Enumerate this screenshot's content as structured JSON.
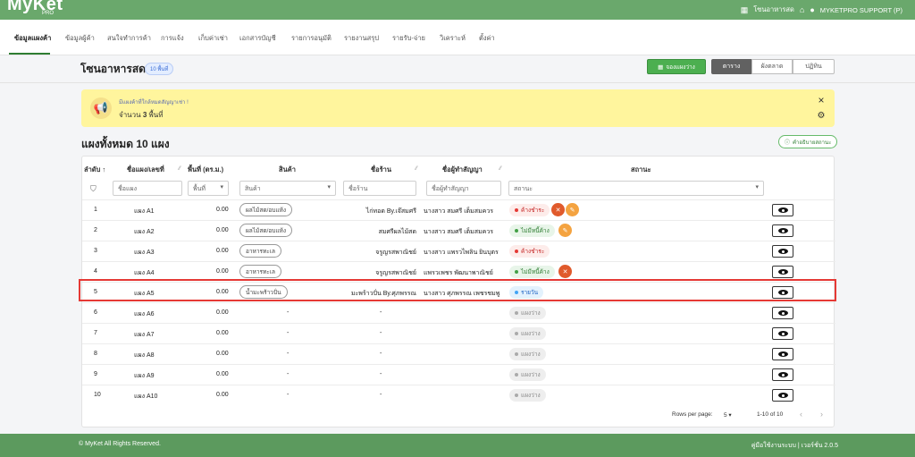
{
  "brand": {
    "logo": "MyKet",
    "sub": "PRO"
  },
  "topbar": {
    "store": "โซนอาหารสด",
    "user": "MYKETPRO SUPPORT (P)"
  },
  "nav": [
    "ข้อมูลแผงค้า",
    "ข้อมูลผู้ค้า",
    "สนใจทำการค้า",
    "การแจ้ง",
    "เก็บค่าเช่า",
    "เอกสารบัญชี",
    "รายการอนุมัติ",
    "รายงานสรุป",
    "รายรับ-จ่าย",
    "วิเคราะห์",
    "ตั้งค่า"
  ],
  "page": {
    "title": "โซนอาหารสด",
    "area_badge": "10 พื้นที่",
    "reserve_button": "จองแผงว่าง",
    "views": [
      "ตาราง",
      "ผังตลาด",
      "ปฏิทิน"
    ]
  },
  "banner": {
    "line1": "มีแผงค้าที่ใกล้หมดสัญญาเช่า !",
    "line2_prefix": "จำนวน",
    "count": "3",
    "line2_suffix": "พื้นที่"
  },
  "section": {
    "title": "แผงทั้งหมด 10 แผง",
    "status_desc_button": "คำอธิบายสถานะ"
  },
  "table": {
    "headers": {
      "no": "ลำดับ ↑",
      "stall": "ชื่อแผง/เลขที่",
      "area": "พื้นที่ (ตร.ม.)",
      "product": "สินค้า",
      "shop": "ชื่อร้าน",
      "tenant": "ชื่อผู้ทำสัญญา",
      "status": "สถานะ"
    },
    "filters": {
      "stall": "ชื่อแผง",
      "area": "พื้นที่",
      "product": "สินค้า",
      "shop": "ชื่อร้าน",
      "tenant": "ชื่อผู้ทำสัญญา",
      "status": "สถานะ"
    },
    "rows": [
      {
        "no": "1",
        "stall": "แผง A1",
        "area": "0.00",
        "product": "ผลไม้สด/อบแห้ง",
        "shop": "ไก่ทอด By.เจ๊สมศรี",
        "tenant": "นางสาว สมศรี เต็มสมควร",
        "status": "ค้างชำระ",
        "status_type": "red",
        "icons": [
          "red",
          "orange"
        ]
      },
      {
        "no": "2",
        "stall": "แผง A2",
        "area": "0.00",
        "product": "ผลไม้สด/อบแห้ง",
        "shop": "สมศรีผลไม้สด",
        "tenant": "นางสาว สมศรี เต็มสมควร",
        "status": "ไม่มีหนี้ค้าง",
        "status_type": "green",
        "icons": [
          "orange"
        ]
      },
      {
        "no": "3",
        "stall": "แผง A3",
        "area": "0.00",
        "product": "อาหารทะเล",
        "shop": "จรูญรสพาณิชย์",
        "tenant": "นางสาว แพรวไพลิน ยินบุตร",
        "status": "ค้างชำระ",
        "status_type": "red",
        "icons": []
      },
      {
        "no": "4",
        "stall": "แผง A4",
        "area": "0.00",
        "product": "อาหารทะเล",
        "shop": "จรูญรสพาณิชย์",
        "tenant": "แพรวเพชร พัฒนาพาณิชย์",
        "status": "ไม่มีหนี้ค้าง",
        "status_type": "green",
        "icons": [
          "red"
        ]
      },
      {
        "no": "5",
        "stall": "แผง A5",
        "area": "0.00",
        "product": "น้ำมะพร้าวปั่น",
        "shop": "มะพร้าวปั่น By.ศุภพรรณ",
        "tenant": "นางสาว ศุภพรรณ เพชรชมพู",
        "status": "รายวัน",
        "status_type": "blue",
        "icons": []
      },
      {
        "no": "6",
        "stall": "แผง A6",
        "area": "0.00",
        "product": "-",
        "shop": "-",
        "tenant": "",
        "status": "แผงว่าง",
        "status_type": "grey",
        "icons": []
      },
      {
        "no": "7",
        "stall": "แผง A7",
        "area": "0.00",
        "product": "-",
        "shop": "-",
        "tenant": "",
        "status": "แผงว่าง",
        "status_type": "grey",
        "icons": []
      },
      {
        "no": "8",
        "stall": "แผง A8",
        "area": "0.00",
        "product": "-",
        "shop": "-",
        "tenant": "",
        "status": "แผงว่าง",
        "status_type": "grey",
        "icons": []
      },
      {
        "no": "9",
        "stall": "แผง A9",
        "area": "0.00",
        "product": "-",
        "shop": "-",
        "tenant": "",
        "status": "แผงว่าง",
        "status_type": "grey",
        "icons": []
      },
      {
        "no": "10",
        "stall": "แผง A10",
        "area": "0.00",
        "product": "-",
        "shop": "-",
        "tenant": "",
        "status": "แผงว่าง",
        "status_type": "grey",
        "icons": []
      }
    ]
  },
  "pagination": {
    "rows_label": "Rows per page:",
    "rows_value": "5",
    "range": "1-10 of 10"
  },
  "footer": {
    "left": "© MyKet All Rights Reserved.",
    "right": "คู่มือใช้งานระบบ | เวอร์ชั่น 2.0.5"
  },
  "colors": {
    "topbar": "#6aa86c",
    "footer": "#5c9a5e",
    "highlight": "#e53935",
    "banner": "#fff59d"
  }
}
